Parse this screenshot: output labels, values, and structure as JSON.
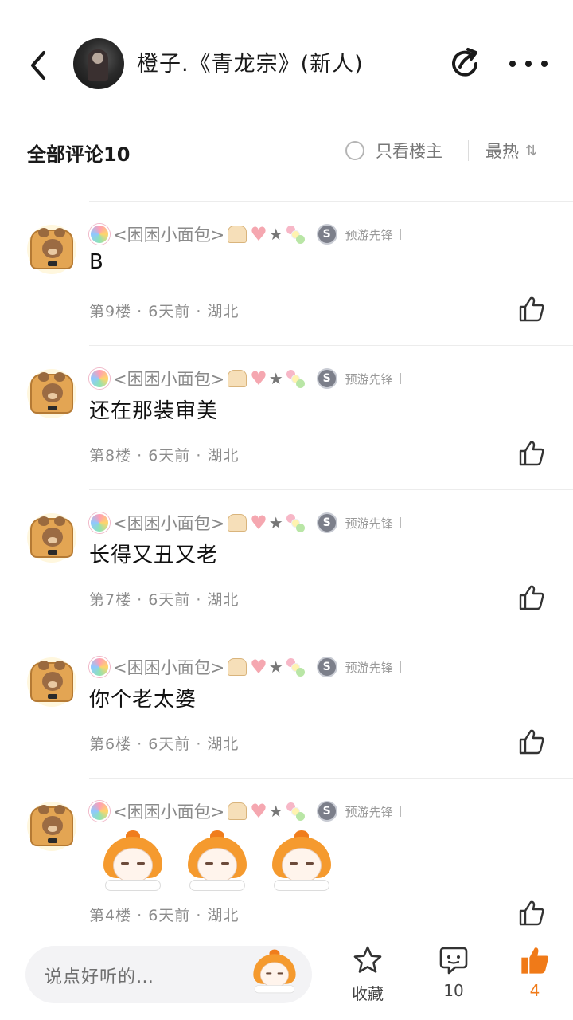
{
  "header": {
    "title": "橙子.《青龙宗》(新人)"
  },
  "filter": {
    "all_comments": "全部评论10",
    "op_only": "只看楼主",
    "sort": "最热",
    "sort_icon": "⇅"
  },
  "comments": [
    {
      "username": "<困困小面包>",
      "badge": "预游先锋",
      "text": "B",
      "meta": "第9楼 · 6天前 · 湖北"
    },
    {
      "username": "<困困小面包>",
      "badge": "预游先锋",
      "text": "还在那装审美",
      "meta": "第8楼 · 6天前 · 湖北"
    },
    {
      "username": "<困困小面包>",
      "badge": "预游先锋",
      "text": "长得又丑又老",
      "meta": "第7楼 · 6天前 · 湖北"
    },
    {
      "username": "<困困小面包>",
      "badge": "预游先锋",
      "text": "你个老太婆",
      "meta": "第6楼 · 6天前 · 湖北"
    },
    {
      "username": "<困困小面包>",
      "badge": "预游先锋",
      "text": "",
      "meta": "第4楼 · 6天前 · 湖北"
    }
  ],
  "bottom": {
    "placeholder": "说点好听的…",
    "collect_label": "收藏",
    "comment_count": "10",
    "like_count": "4"
  },
  "colors": {
    "accent": "#f07a18",
    "muted_text": "#8c8c8c"
  }
}
